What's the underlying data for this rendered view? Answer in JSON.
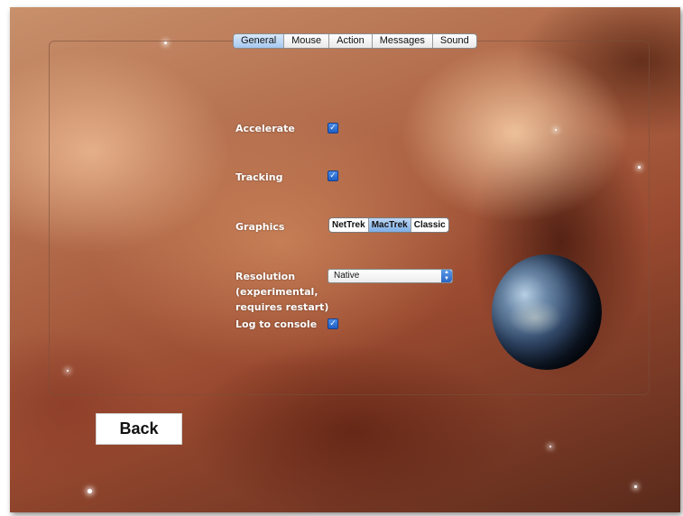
{
  "tabs": [
    {
      "label": "General",
      "selected": true
    },
    {
      "label": "Mouse",
      "selected": false
    },
    {
      "label": "Action",
      "selected": false
    },
    {
      "label": "Messages",
      "selected": false
    },
    {
      "label": "Sound",
      "selected": false
    }
  ],
  "settings": {
    "accelerate": {
      "label": "Accelerate",
      "checked": true
    },
    "tracking": {
      "label": "Tracking",
      "checked": true
    },
    "graphics": {
      "label": "Graphics",
      "options": [
        "NetTrek",
        "MacTrek",
        "Classic"
      ],
      "selected": "MacTrek"
    },
    "resolution": {
      "label_line1": "Resolution",
      "label_line2": "(experimental,",
      "label_line3": "requires restart)",
      "value": "Native"
    },
    "log_to_console": {
      "label": "Log to console",
      "checked": true
    }
  },
  "back_button": {
    "label": "Back"
  },
  "colors": {
    "accent_blue": "#2f6fd6",
    "label_text": "#ffffff"
  },
  "icons": {
    "checkbox": "checkmark-icon",
    "select_arrows": "up-down-arrows-icon"
  }
}
